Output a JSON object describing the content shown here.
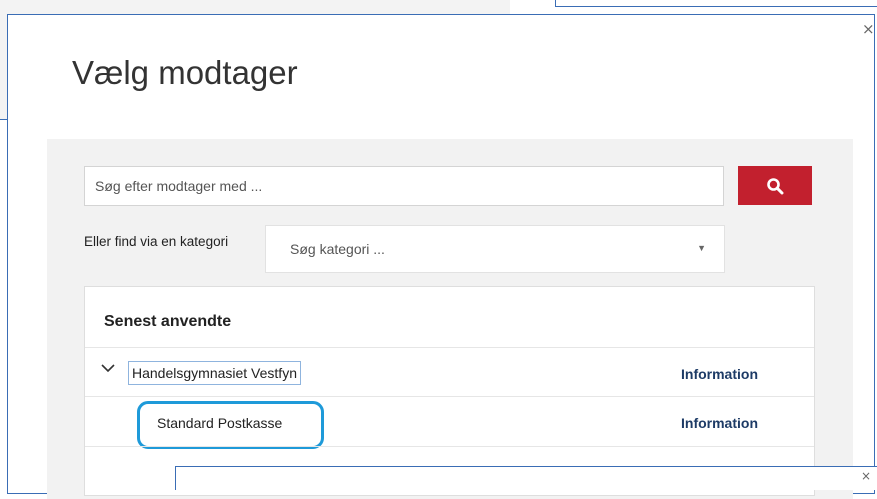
{
  "dialog": {
    "title": "Vælg modtager",
    "close_label": "×"
  },
  "search": {
    "placeholder": "Søg efter modtager med ...",
    "button_icon": "search-icon"
  },
  "category": {
    "label": "Eller find via en kategori",
    "placeholder": "Søg kategori ...",
    "caret": "▼"
  },
  "recent": {
    "heading": "Senest anvendte",
    "items": [
      {
        "name": "Handelsgymnasiet Vestfyn",
        "info_label": "Information",
        "expanded": true
      },
      {
        "name": "Standard Postkasse",
        "info_label": "Information"
      }
    ]
  },
  "lower_window": {
    "close_label": "×"
  },
  "colors": {
    "accent_red": "#c2202e",
    "link_blue": "#1d3b66",
    "highlight": "#1e9ad9",
    "window_border": "#3a6db5"
  }
}
